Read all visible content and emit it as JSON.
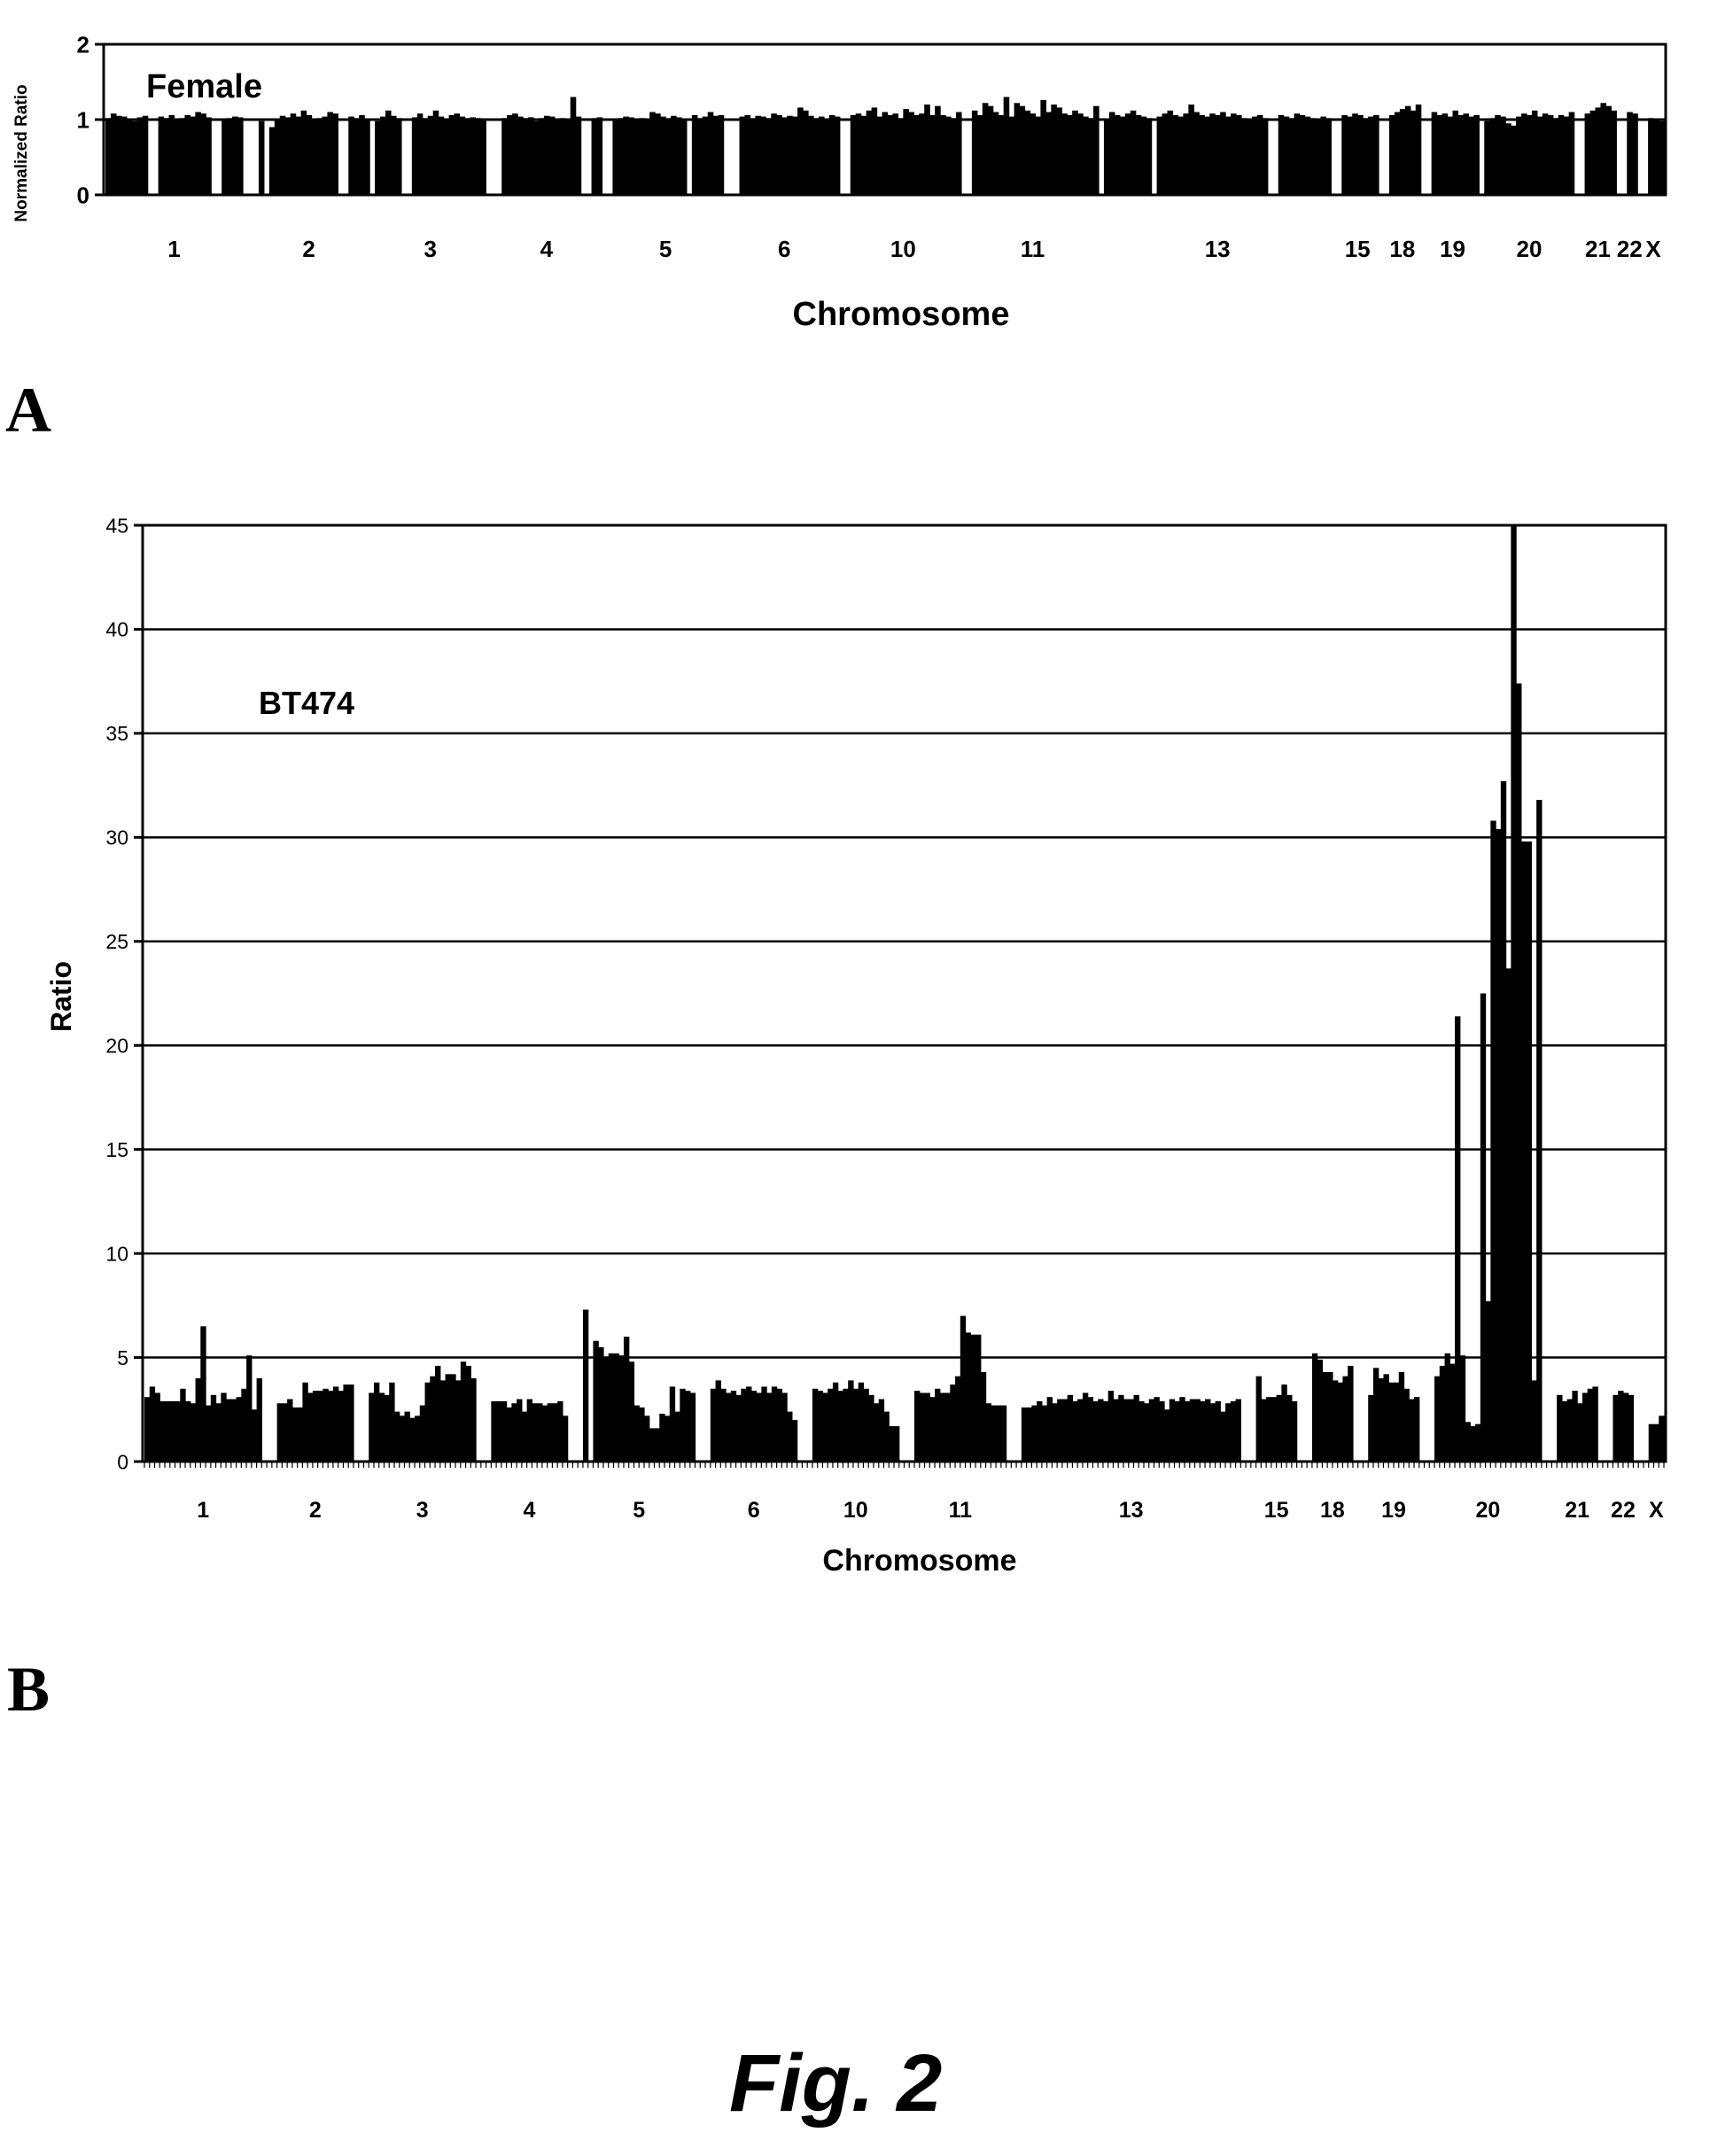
{
  "figure": {
    "caption": "Fig. 2",
    "panel_labels": [
      "A",
      "B"
    ]
  },
  "chart_data": [
    {
      "type": "bar",
      "panel": "A",
      "title": "Female",
      "xlabel": "Chromosome",
      "ylabel": "Normalized Ratio",
      "ylim": [
        0,
        2
      ],
      "yticks": [
        "0",
        "1",
        "2"
      ],
      "grid": false,
      "reference_line": 1,
      "categories": [
        "1",
        "2",
        "3",
        "4",
        "5",
        "6",
        "10",
        "11",
        "13",
        "15",
        "18",
        "19",
        "20",
        "21",
        "22",
        "X"
      ],
      "segments": [
        {
          "chromosome": "1",
          "values": [
            1.02,
            1.08,
            1.05,
            1.04,
            1.0,
            0.98,
            1.03,
            1.05,
            0,
            0,
            1.04,
            1.02,
            1.06,
            1.0,
            1.02,
            1.06,
            1.04,
            1.1,
            1.08,
            1.03,
            0,
            0,
            1.0,
            1.02,
            1.04,
            1.03
          ]
        },
        {
          "chromosome": "2",
          "values": [
            0,
            0,
            0.98,
            0,
            0.9,
            1.0,
            1.05,
            1.03,
            1.08,
            1.04,
            1.12,
            1.06,
            1.0,
            1.02,
            1.04,
            1.1,
            1.08,
            0,
            0,
            1.04,
            1.02,
            1.06,
            1.0
          ]
        },
        {
          "chromosome": "3",
          "values": [
            0.98,
            1.04,
            1.12,
            1.05,
            1.02,
            0,
            0,
            1.03,
            1.08,
            1.02,
            1.05,
            1.12,
            1.04,
            1.0,
            1.06,
            1.08,
            1.04,
            1.02,
            1.03,
            1.02,
            1.0
          ]
        },
        {
          "chromosome": "4",
          "values": [
            0,
            0,
            1.02,
            1.06,
            1.08,
            1.04,
            1.02,
            1.03,
            0.98,
            1.02,
            1.05,
            1.04,
            1.0,
            1.02,
            1.0,
            1.3,
            1.04,
            0,
            0,
            1.02,
            1.03
          ]
        },
        {
          "chromosome": "5",
          "values": [
            0,
            1.0,
            1.02,
            1.04,
            1.03,
            1.01,
            1.02,
            1.0,
            1.1,
            1.08,
            1.04,
            1.02,
            1.05,
            1.03,
            1.0,
            0,
            1.06,
            1.02,
            1.04,
            1.1,
            1.05,
            1.06
          ]
        },
        {
          "chromosome": "6",
          "values": [
            0,
            0,
            1.04,
            1.06,
            1.02,
            1.05,
            1.04,
            1.02,
            1.08,
            1.06,
            1.03,
            1.05,
            1.04,
            1.16,
            1.12,
            1.05,
            1.02,
            1.04,
            1.0,
            1.06,
            1.04
          ]
        },
        {
          "chromosome": "10",
          "values": [
            0,
            1.06,
            1.08,
            1.05,
            1.12,
            1.16,
            1.04,
            1.1,
            1.06,
            1.08,
            1.02,
            1.14,
            1.1,
            1.06,
            1.08,
            1.2,
            1.06,
            1.18,
            1.06,
            1.04,
            1.02,
            1.1
          ]
        },
        {
          "chromosome": "11",
          "values": [
            0,
            1.12,
            1.06,
            1.22,
            1.18,
            1.1,
            1.06,
            1.3,
            1.04,
            1.22,
            1.18,
            1.12,
            1.08,
            1.04,
            1.26,
            1.1,
            1.2,
            1.16,
            1.08,
            1.06,
            1.12,
            1.08,
            1.04,
            1.02,
            1.18
          ]
        },
        {
          "chromosome": "13",
          "values": [
            1.0,
            1.1,
            1.06,
            1.04,
            1.08,
            1.12,
            1.06,
            1.04,
            1.02,
            0,
            1.04,
            1.08,
            1.12,
            1.06,
            1.04,
            1.08,
            1.2,
            1.1,
            1.06,
            1.04,
            1.08,
            1.06,
            1.1,
            1.04,
            1.08,
            1.06,
            1.02,
            1.0,
            1.04,
            1.06,
            1.02,
            0,
            0,
            1.06,
            1.04,
            1.02,
            1.08,
            1.06,
            1.04,
            1.02,
            1.0,
            1.04,
            1.02
          ]
        },
        {
          "chromosome": "15",
          "values": [
            0,
            1.06,
            1.04,
            1.08,
            1.06,
            1.02,
            1.04,
            1.06
          ]
        },
        {
          "chromosome": "18",
          "values": [
            0,
            1.06,
            1.1,
            1.14,
            1.18,
            1.12,
            1.2
          ]
        },
        {
          "chromosome": "19",
          "values": [
            0,
            1.1,
            1.06,
            1.08,
            1.04,
            1.12,
            1.06,
            1.08,
            1.04,
            1.06
          ]
        },
        {
          "chromosome": "20",
          "values": [
            0.98,
            1.02,
            1.06,
            1.04,
            0.95,
            0.92,
            1.04,
            1.08,
            1.06,
            1.12,
            1.04,
            1.08,
            1.06,
            1.02,
            1.06,
            1.04,
            1.1
          ]
        },
        {
          "chromosome": "21",
          "values": [
            0,
            1.08,
            1.12,
            1.16,
            1.22,
            1.18,
            1.12
          ]
        },
        {
          "chromosome": "22",
          "values": [
            0,
            1.1,
            1.08
          ]
        },
        {
          "chromosome": "X",
          "values": [
            0,
            1.02,
            1.0,
            0.98
          ]
        }
      ]
    },
    {
      "type": "bar",
      "panel": "B",
      "title": "BT474",
      "xlabel": "Chromosome",
      "ylabel": "Ratio",
      "ylim": [
        0,
        45
      ],
      "yticks": [
        "0",
        "5",
        "10",
        "15",
        "20",
        "25",
        "30",
        "35",
        "40",
        "45"
      ],
      "grid": true,
      "categories": [
        "1",
        "2",
        "3",
        "4",
        "5",
        "6",
        "10",
        "11",
        "13",
        "15",
        "18",
        "19",
        "20",
        "21",
        "22",
        "X"
      ],
      "segments": [
        {
          "chromosome": "1",
          "values": [
            3.1,
            3.6,
            3.3,
            2.9,
            2.9,
            2.9,
            2.9,
            3.5,
            2.9,
            2.8,
            4.0,
            6.5,
            2.7,
            3.2,
            2.8,
            3.3,
            3.0,
            3.0,
            3.1,
            3.5,
            5.1,
            2.5,
            4.0
          ]
        },
        {
          "chromosome": "2",
          "values": [
            2.8,
            2.8,
            3.0,
            2.6,
            2.6,
            3.8,
            3.3,
            3.4,
            3.4,
            3.5,
            3.4,
            3.6,
            3.4,
            3.7,
            3.7
          ]
        },
        {
          "chromosome": "3",
          "values": [
            3.3,
            3.8,
            3.3,
            3.2,
            3.8,
            2.4,
            2.2,
            2.4,
            2.1,
            2.2,
            2.7,
            3.8,
            4.1,
            4.6,
            3.9,
            4.2,
            4.2,
            3.9,
            4.8,
            4.6,
            4.0
          ]
        },
        {
          "chromosome": "4",
          "values": [
            2.9,
            2.9,
            2.9,
            2.6,
            2.8,
            3.0,
            2.4,
            3.0,
            2.8,
            2.8,
            2.7,
            2.8,
            2.8,
            2.9,
            2.2
          ]
        },
        {
          "chromosome": "5",
          "values": [
            7.3,
            0,
            5.8,
            5.5,
            5.0,
            5.2,
            5.2,
            5.1,
            6.0,
            4.8,
            2.7,
            2.6,
            2.2,
            1.6,
            1.6,
            2.3,
            2.2,
            3.6,
            2.4,
            3.5,
            3.4,
            3.3
          ]
        },
        {
          "chromosome": "6",
          "values": [
            3.5,
            3.9,
            3.5,
            3.3,
            3.4,
            3.2,
            3.5,
            3.6,
            3.4,
            3.3,
            3.6,
            3.3,
            3.6,
            3.5,
            3.3,
            2.4,
            2.0
          ]
        },
        {
          "chromosome": "10",
          "values": [
            3.5,
            3.4,
            3.3,
            3.5,
            3.8,
            3.4,
            3.5,
            3.9,
            3.5,
            3.8,
            3.5,
            3.2,
            2.8,
            3.0,
            2.4,
            1.7,
            1.7
          ]
        },
        {
          "chromosome": "11",
          "values": [
            3.4,
            3.3,
            3.3,
            3.1,
            3.5,
            3.3,
            3.3,
            3.7,
            4.1,
            7.0,
            6.2,
            6.1,
            6.1,
            4.3,
            2.8,
            2.7,
            2.7,
            2.7
          ]
        },
        {
          "chromosome": "13",
          "values": [
            2.6,
            2.6,
            2.7,
            2.9,
            2.7,
            3.1,
            2.8,
            3.0,
            3.0,
            3.2,
            2.9,
            3.0,
            3.3,
            3.1,
            2.9,
            3.0,
            2.9,
            3.4,
            3.0,
            3.2,
            3.0,
            3.0,
            3.2,
            2.9,
            2.8,
            3.0,
            3.1,
            2.9,
            2.5,
            3.0,
            2.9,
            3.1,
            2.9,
            3.0,
            3.0,
            2.9,
            3.0,
            2.8,
            2.9,
            2.4,
            2.8,
            2.9,
            3.0
          ]
        },
        {
          "chromosome": "15",
          "values": [
            4.1,
            3.0,
            3.1,
            3.1,
            3.2,
            3.7,
            3.2,
            2.9
          ]
        },
        {
          "chromosome": "18",
          "values": [
            5.2,
            4.9,
            4.3,
            4.3,
            3.9,
            3.8,
            4.1,
            4.6
          ]
        },
        {
          "chromosome": "19",
          "values": [
            3.2,
            4.5,
            4.0,
            4.2,
            3.8,
            3.8,
            4.3,
            3.5,
            3.0,
            3.1
          ]
        },
        {
          "chromosome": "20",
          "values": [
            4.1,
            4.6,
            5.2,
            4.7,
            21.4,
            5.1,
            1.9,
            1.7,
            1.8,
            22.5,
            7.7,
            30.8,
            30.4,
            32.7,
            23.7,
            45.0,
            37.4,
            29.8,
            29.8,
            3.9,
            31.8
          ]
        },
        {
          "chromosome": "21",
          "values": [
            3.2,
            2.9,
            3.0,
            3.4,
            2.8,
            3.3,
            3.5,
            3.6
          ]
        },
        {
          "chromosome": "22",
          "values": [
            3.2,
            3.4,
            3.3,
            3.2
          ]
        },
        {
          "chromosome": "X",
          "values": [
            1.8,
            1.8,
            2.2
          ]
        }
      ]
    }
  ]
}
